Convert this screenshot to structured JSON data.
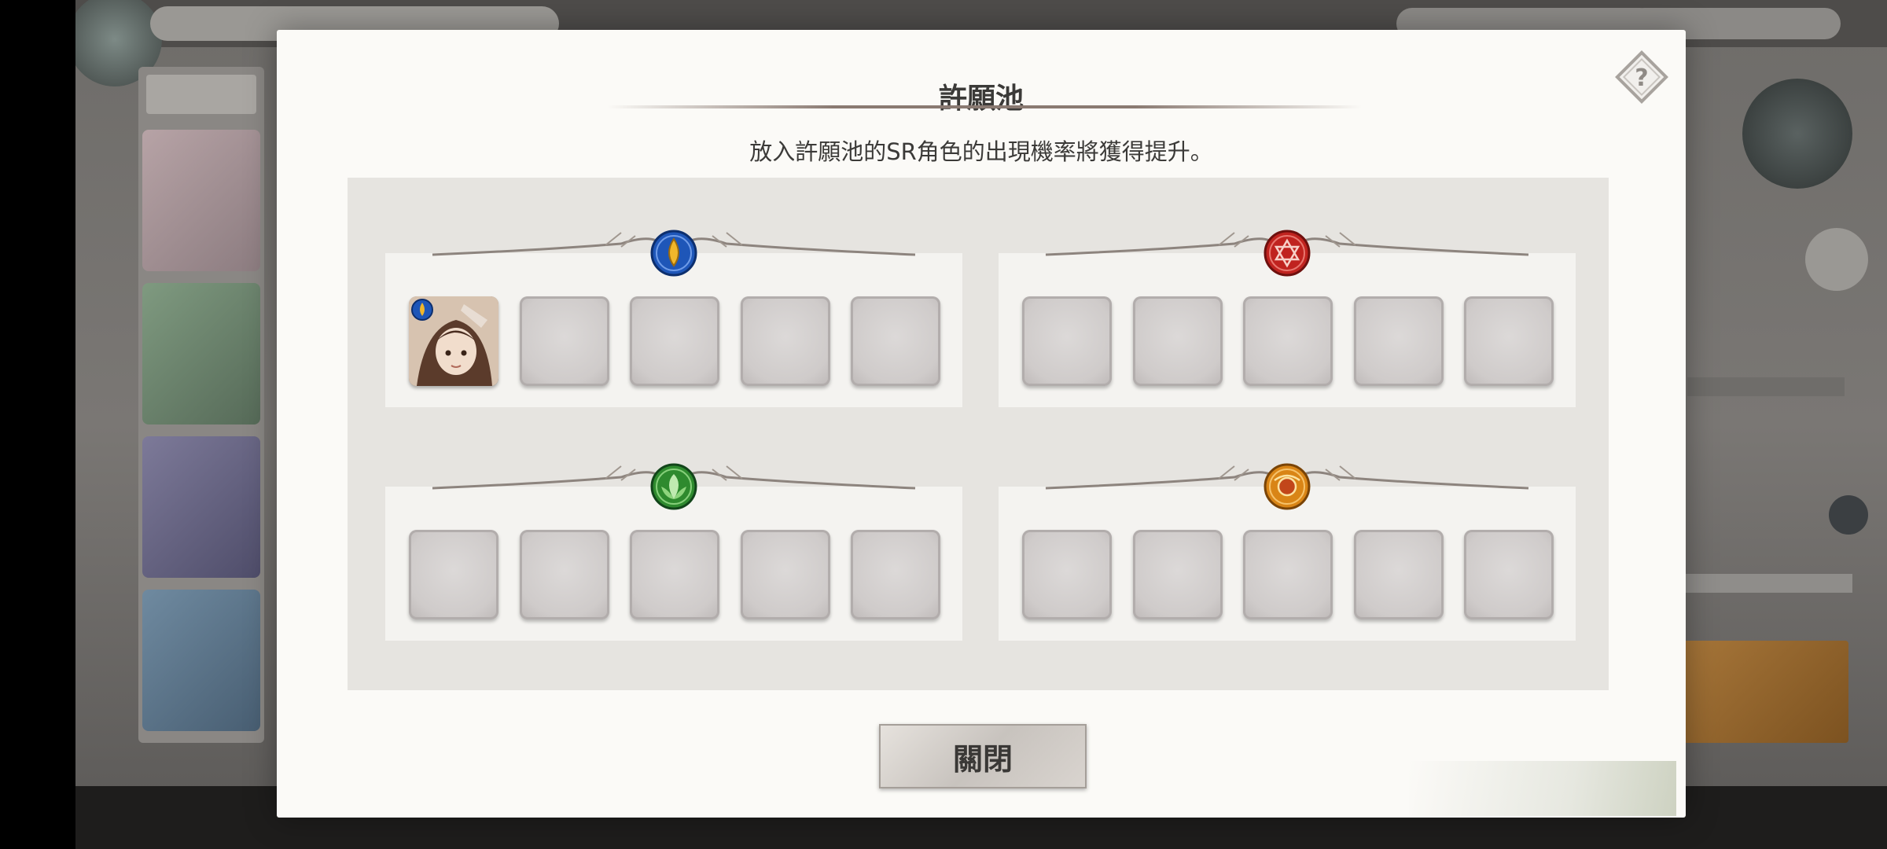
{
  "dialog": {
    "title": "許願池",
    "description": "放入許願池的SR角色的出現機率將獲得提升。",
    "close_label": "關閉",
    "help_icon": "question-mark-icon"
  },
  "groups": [
    {
      "element": "water",
      "icon": "water-drop-icon",
      "color": "#1e56b8",
      "slots_filled": 1,
      "slot_count": 5
    },
    {
      "element": "fire",
      "icon": "fire-hexagram-icon",
      "color": "#c0231f",
      "slots_filled": 0,
      "slot_count": 5
    },
    {
      "element": "wind",
      "icon": "wind-leaf-icon",
      "color": "#2e8a2e",
      "slots_filled": 0,
      "slot_count": 5
    },
    {
      "element": "earth",
      "icon": "earth-orb-icon",
      "color": "#d98516",
      "slots_filled": 0,
      "slot_count": 5
    }
  ],
  "colors": {
    "dialog_bg": "#fbfaf7",
    "pool_bg": "#e6e4e0",
    "group_bg": "#f4f3f0",
    "slot_bg": "#cfcbca"
  }
}
